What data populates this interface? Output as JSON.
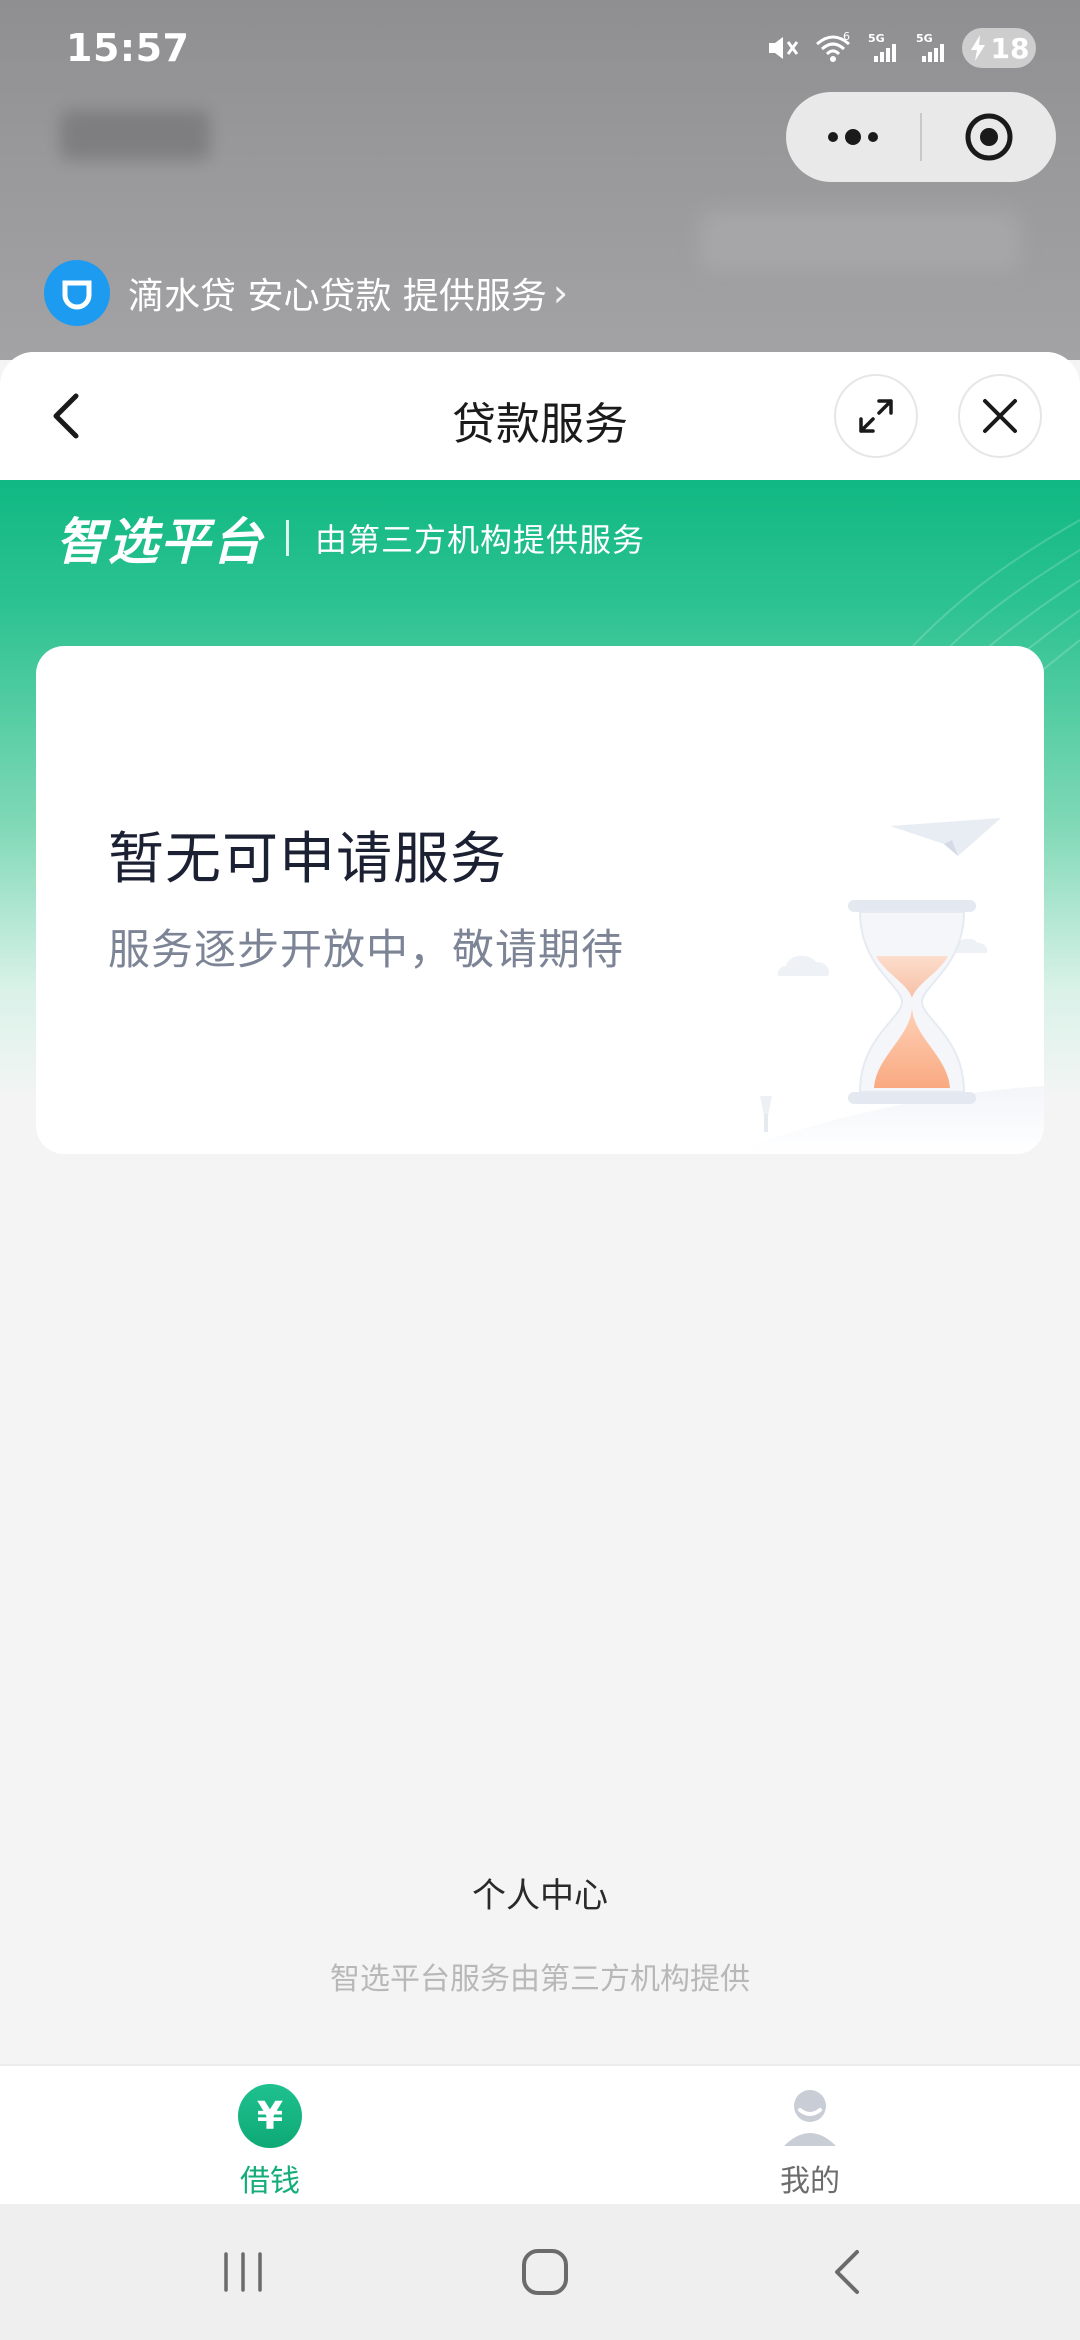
{
  "status_bar": {
    "time": "15:57",
    "battery_level": "18",
    "network_labels": [
      "5G",
      "5G"
    ],
    "wifi_label": "6"
  },
  "host": {
    "provider_text": "滴水贷 安心贷款 提供服务",
    "provider_chevron": "›"
  },
  "capsule": {
    "more_icon": "more-dots-icon",
    "target_icon": "target-icon"
  },
  "sheet": {
    "title": "贷款服务"
  },
  "platform": {
    "name": "智选平台",
    "description": "由第三方机构提供服务"
  },
  "card": {
    "title": "暂无可申请服务",
    "subtitle": "服务逐步开放中，敬请期待"
  },
  "footer": {
    "personal_center": "个人中心",
    "note": "智选平台服务由第三方机构提供"
  },
  "tabs": [
    {
      "label": "借钱",
      "icon": "yuan-icon",
      "active": true,
      "icon_glyph": "¥"
    },
    {
      "label": "我的",
      "icon": "user-icon",
      "active": false
    }
  ],
  "colors": {
    "brand_green": "#10b882",
    "active_tab": "#13ad7a",
    "provider_logo": "#1d9bf0"
  }
}
